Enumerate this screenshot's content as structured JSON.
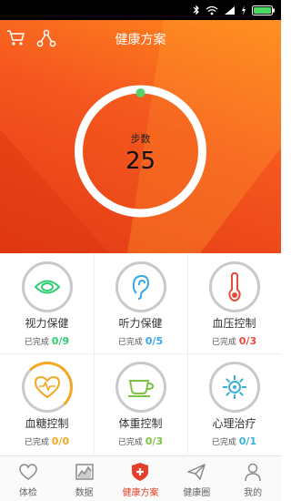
{
  "status_bar": {
    "icons": [
      "bluetooth-icon",
      "wifi-icon",
      "signal-icon",
      "charging-icon",
      "battery-icon"
    ]
  },
  "header": {
    "title": "健康方案",
    "cart_icon": "cart-icon",
    "share_icon": "share-icon"
  },
  "ring": {
    "label": "步数",
    "value": "25",
    "progress": 0.0
  },
  "plans": [
    {
      "name": "视力保健",
      "done_label": "已完成",
      "done": "0/9",
      "done_color": "#2ecc71",
      "icon": "eye-icon",
      "icon_color": "#2ecc71",
      "progress": 0
    },
    {
      "name": "听力保健",
      "done_label": "已完成",
      "done": "0/5",
      "done_color": "#3aa7e6",
      "icon": "ear-icon",
      "icon_color": "#3aa7e6",
      "progress": 0
    },
    {
      "name": "血压控制",
      "done_label": "已完成",
      "done": "0/3",
      "done_color": "#e74c3c",
      "icon": "thermometer-icon",
      "icon_color": "#e74c3c",
      "progress": 0
    },
    {
      "name": "血糖控制",
      "done_label": "已完成",
      "done": "0/0",
      "done_color": "#f5a623",
      "icon": "heart-pulse-icon",
      "icon_color": "#f5a623",
      "progress": 0.4
    },
    {
      "name": "体重控制",
      "done_label": "已完成",
      "done": "0/3",
      "done_color": "#7dc243",
      "icon": "cup-icon",
      "icon_color": "#7dc243",
      "progress": 0
    },
    {
      "name": "心理治疗",
      "done_label": "已完成",
      "done": "0/1",
      "done_color": "#3ab0d8",
      "icon": "sun-icon",
      "icon_color": "#3ab0d8",
      "progress": 0
    }
  ],
  "tabs": [
    {
      "label": "体检",
      "icon": "heart-outline-icon",
      "active": false
    },
    {
      "label": "数据",
      "icon": "chart-icon",
      "active": false
    },
    {
      "label": "健康方案",
      "icon": "shield-plus-icon",
      "active": true
    },
    {
      "label": "健康圈",
      "icon": "paper-plane-icon",
      "active": false
    },
    {
      "label": "我的",
      "icon": "person-icon",
      "active": false
    }
  ],
  "colors": {
    "brand": "#e5402b",
    "hero_start": "#ff8a1e",
    "hero_end": "#e23a15",
    "ring": "#ffffff",
    "ring_dot": "#5bd06a"
  }
}
